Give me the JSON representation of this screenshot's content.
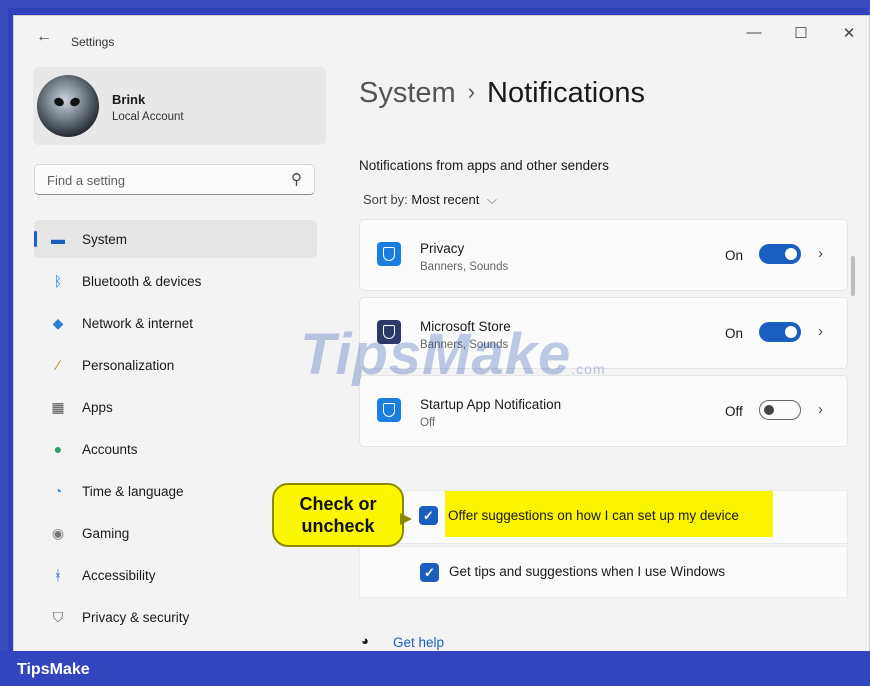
{
  "window": {
    "title": "Settings",
    "controls": {
      "minimize": "—",
      "maximize": "☐",
      "close": "✕"
    }
  },
  "account": {
    "name": "Brink",
    "type": "Local Account"
  },
  "search": {
    "placeholder": "Find a setting"
  },
  "sidebar": {
    "items": [
      {
        "label": "System",
        "icon": "system-icon",
        "glyph": "▬",
        "color": "#1a5fbf",
        "selected": true
      },
      {
        "label": "Bluetooth & devices",
        "icon": "bluetooth-icon",
        "glyph": "ᛒ",
        "color": "#1a7ee0"
      },
      {
        "label": "Network & internet",
        "icon": "network-icon",
        "glyph": "◆",
        "color": "#2a7fd6"
      },
      {
        "label": "Personalization",
        "icon": "brush-icon",
        "glyph": "∕",
        "color": "#c77b2a"
      },
      {
        "label": "Apps",
        "icon": "apps-icon",
        "glyph": "▦",
        "color": "#555555"
      },
      {
        "label": "Accounts",
        "icon": "accounts-icon",
        "glyph": "●",
        "color": "#2aa168"
      },
      {
        "label": "Time & language",
        "icon": "time-language-icon",
        "glyph": "◔",
        "color": "#3a8ad8"
      },
      {
        "label": "Gaming",
        "icon": "gaming-icon",
        "glyph": "◉",
        "color": "#777777"
      },
      {
        "label": "Accessibility",
        "icon": "accessibility-icon",
        "glyph": "ᚼ",
        "color": "#1a5fbf"
      },
      {
        "label": "Privacy & security",
        "icon": "shield-icon",
        "glyph": "⛉",
        "color": "#666666"
      }
    ]
  },
  "main": {
    "breadcrumb": {
      "parent": "System",
      "separator": "›",
      "current": "Notifications"
    },
    "section_heading": "Notifications from apps and other senders",
    "sort": {
      "label": "Sort by:",
      "value": "Most recent",
      "chevron": "⌵"
    },
    "apps": [
      {
        "name": "Privacy",
        "subtitle": "Banners, Sounds",
        "state": "On",
        "on": true,
        "icon": "privacy-shield-icon",
        "icon_color": "#1a7ee0"
      },
      {
        "name": "Microsoft Store",
        "subtitle": "Banners, Sounds",
        "state": "On",
        "on": true,
        "icon": "store-icon",
        "icon_color": "#2a3b6a"
      },
      {
        "name": "Startup App Notification",
        "subtitle": "Off",
        "state": "Off",
        "on": false,
        "icon": "startup-app-icon",
        "icon_color": "#1a7ee0"
      }
    ],
    "checkboxes": [
      {
        "label": "Offer suggestions on how I can set up my device",
        "checked": true
      },
      {
        "label": "Get tips and suggestions when I use Windows",
        "checked": true
      }
    ],
    "help": {
      "label": "Get help"
    },
    "chevron": "›",
    "check": "✓"
  },
  "annotation": {
    "callout_line1": "Check or",
    "callout_line2": "uncheck"
  },
  "watermark": {
    "text": "TipsMake",
    "suffix": ".com"
  },
  "footer": {
    "brand": "TipsMake"
  },
  "colors": {
    "accent": "#1a5fbf",
    "highlight": "#fbf400",
    "frame": "#3245bf"
  }
}
